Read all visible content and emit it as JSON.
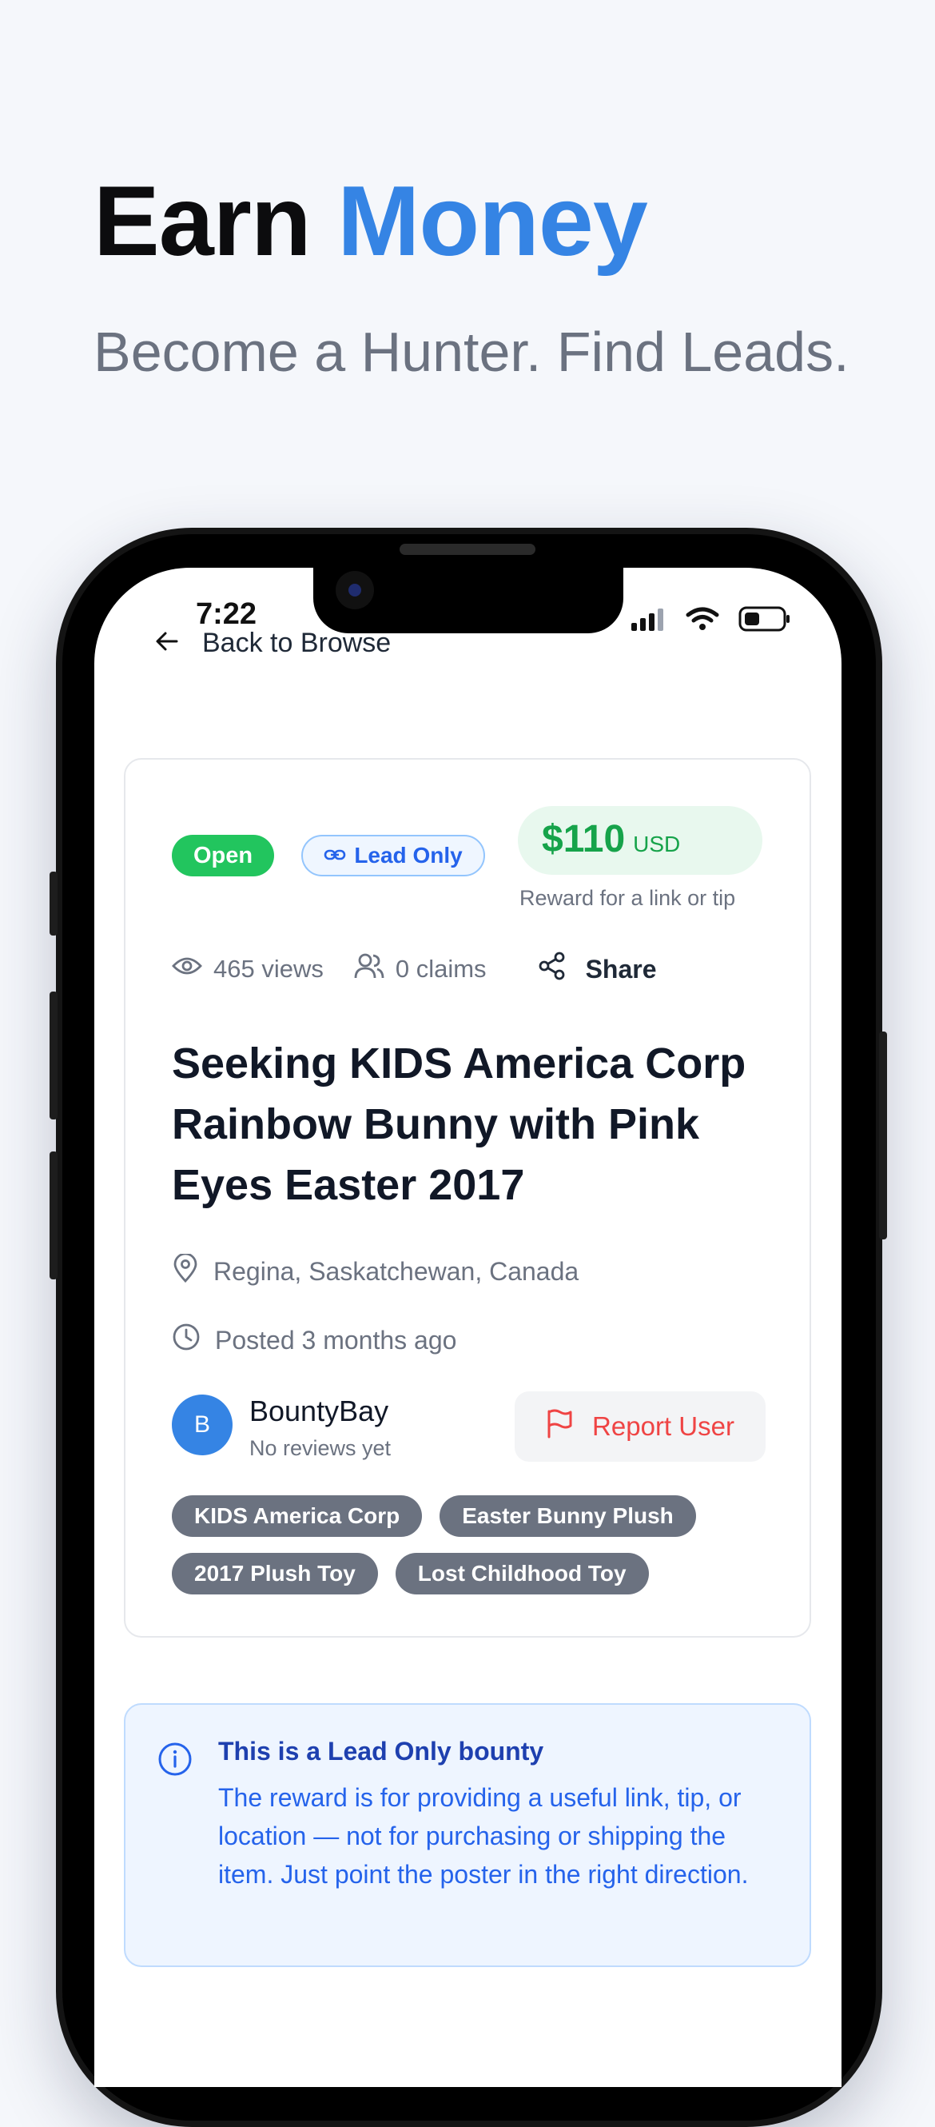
{
  "promo": {
    "title_part1": "Earn",
    "title_part2": "Money",
    "subtitle": "Become a Hunter. Find Leads."
  },
  "status_bar": {
    "time": "7:22"
  },
  "nav": {
    "back_label": "Back to Browse"
  },
  "bounty": {
    "status_badge": "Open",
    "type_badge": "Lead Only",
    "reward_amount": "$110",
    "reward_currency": "USD",
    "reward_caption": "Reward for a link or tip",
    "views": "465 views",
    "claims": "0 claims",
    "share_label": "Share",
    "title": "Seeking KIDS America Corp Rainbow Bunny with Pink Eyes Easter 2017",
    "location": "Regina, Saskatchewan, Canada",
    "posted": "Posted 3 months ago",
    "poster": {
      "initial": "B",
      "name": "BountyBay",
      "reviews": "No reviews yet"
    },
    "report_label": "Report User",
    "tags": [
      "KIDS America Corp",
      "Easter Bunny Plush",
      "2017 Plush Toy",
      "Lost Childhood Toy"
    ]
  },
  "info": {
    "title": "This is a Lead Only bounty",
    "body": "The reward is for providing a useful link, tip, or location — not for purchasing or shipping the item. Just point the poster in the right direction."
  },
  "colors": {
    "accent": "#3584e4",
    "open_badge": "#22c55e",
    "reward_green": "#16a34a",
    "report_red": "#ef4444",
    "tag_gray": "#6b7280"
  }
}
